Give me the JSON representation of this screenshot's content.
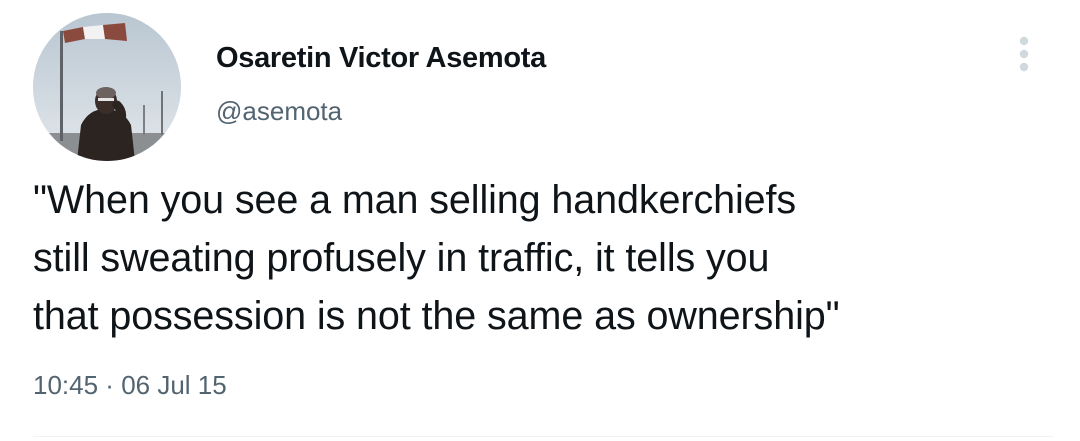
{
  "tweet": {
    "display_name": "Osaretin Victor Asemota",
    "handle": "@asemota",
    "text": "\"When you see a man selling handkerchiefs\nstill sweating profusely in traffic, it tells you\nthat possession is not the same as ownership\"",
    "time": "10:45",
    "separator": " · ",
    "date": "06 Jul 15"
  },
  "icons": {
    "more": "more-vertical-icon"
  },
  "colors": {
    "text_primary": "#0f1419",
    "text_secondary": "#536471",
    "icon_muted": "#cfd9de"
  }
}
